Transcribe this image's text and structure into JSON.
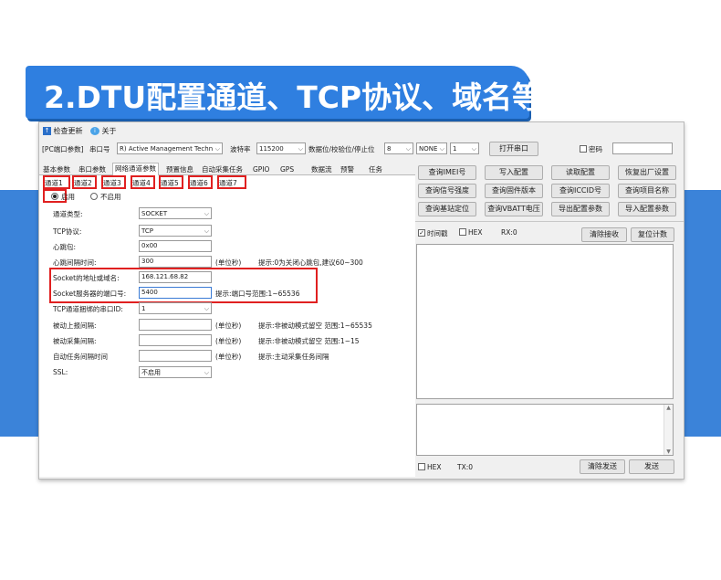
{
  "banner": {
    "title": "2.DTU配置通道、TCP协议、域名等。"
  },
  "toolbar": {
    "check_update": "检查更新",
    "about": "关于"
  },
  "serial": {
    "section_label": "[PC端口参数]",
    "port_label": "串口号",
    "port_value": "R) Active Management Techn",
    "baud_label": "波特率",
    "baud_value": "115200",
    "frame_label": "数据位/校验位/停止位",
    "data_bits": "8",
    "parity": "NONE",
    "stop_bits": "1",
    "open_button": "打开串口",
    "password_label": "密码"
  },
  "tabs": [
    "基本参数",
    "串口参数",
    "网络通道参数",
    "预置信息",
    "自动采集任务",
    "GPIO",
    "GPS",
    "数据流",
    "预警",
    "任务"
  ],
  "channels": [
    "通道1",
    "通道2",
    "通道3",
    "通道4",
    "通道5",
    "通道6",
    "通道7"
  ],
  "enable": {
    "on": "启用",
    "off": "不启用"
  },
  "form": {
    "channel_type_label": "通道类型:",
    "channel_type": "SOCKET",
    "tcp_label": "TCP协议:",
    "tcp": "TCP",
    "heartbeat_label": "心跳包:",
    "heartbeat": "0x00",
    "heartbeat_interval_label": "心跳间隔时间:",
    "heartbeat_interval": "300",
    "heartbeat_unit": "(单位秒)",
    "heartbeat_hint": "提示:0为关闭心跳包,建议60~300",
    "socket_addr_label": "Socket的地址或域名:",
    "socket_addr": "168.121.68.82",
    "socket_port_label": "Socket服务器的端口号:",
    "socket_port": "5400",
    "socket_port_hint": "提示:端口号范围:1~65536",
    "tcp_bind_label": "TCP通道捆绑的串口ID:",
    "tcp_bind": "1",
    "passive_report_label": "被动上报间隔:",
    "passive_report_unit": "(单位秒)",
    "passive_report_hint": "提示:非被动模式留空 范围:1~65535",
    "passive_collect_label": "被动采集间隔:",
    "passive_collect_unit": "(单位秒)",
    "passive_collect_hint": "提示:非被动模式留空 范围:1~15",
    "auto_task_label": "自动任务间隔时间",
    "auto_task_unit": "(单位秒)",
    "auto_task_hint": "提示:主动采集任务间隔",
    "ssl_label": "SSL:",
    "ssl": "不启用"
  },
  "actions": [
    [
      "查询IMEI号",
      "写入配置",
      "读取配置",
      "恢复出厂设置"
    ],
    [
      "查询信号强度",
      "查询固件版本",
      "查询ICCID号",
      "查询项目名称"
    ],
    [
      "查询基站定位",
      "查询VBATT电压",
      "导出配置参数",
      "导入配置参数"
    ]
  ],
  "receive": {
    "timestamp_label": "时间戳",
    "hex_label": "HEX",
    "rx": "RX:0",
    "clear": "清除接收",
    "reset": "复位计数"
  },
  "send": {
    "hex_label": "HEX",
    "tx": "TX:0",
    "clear": "清除发送",
    "send": "发送"
  }
}
